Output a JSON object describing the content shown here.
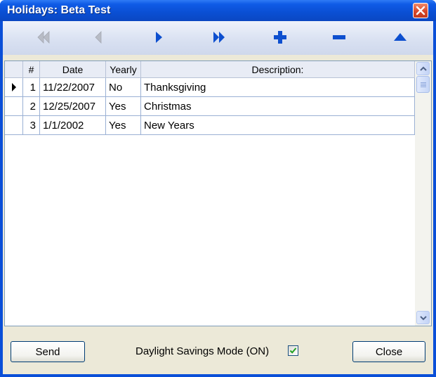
{
  "window": {
    "title": "Holidays: Beta Test"
  },
  "toolbar": {
    "buttons": [
      {
        "name": "first-record-icon",
        "enabled": false
      },
      {
        "name": "previous-record-icon",
        "enabled": false
      },
      {
        "name": "next-record-icon",
        "enabled": true
      },
      {
        "name": "last-record-icon",
        "enabled": true
      },
      {
        "name": "add-record-icon",
        "enabled": true
      },
      {
        "name": "delete-record-icon",
        "enabled": true
      },
      {
        "name": "post-edit-icon",
        "enabled": true
      }
    ]
  },
  "grid": {
    "columns": [
      "#",
      "Date",
      "Yearly",
      "Description:"
    ],
    "rows": [
      {
        "num": "1",
        "date": "11/22/2007",
        "yearly": "No",
        "description": "Thanksgiving",
        "current": true
      },
      {
        "num": "2",
        "date": "12/25/2007",
        "yearly": "Yes",
        "description": "Christmas",
        "current": false
      },
      {
        "num": "3",
        "date": "1/1/2002",
        "yearly": "Yes",
        "description": "New Years",
        "current": false
      }
    ]
  },
  "footer": {
    "send_label": "Send",
    "dst_label": "Daylight Savings Mode (ON)",
    "dst_checked": true,
    "close_label": "Close"
  },
  "colors": {
    "titlebar": "#0a4fd3",
    "toolbar_icon": "#0d4fcf",
    "toolbar_icon_disabled": "#b8bcc6",
    "close_button": "#d9482a",
    "checkmark": "#21a121",
    "grid_line": "#9ab0d4"
  }
}
